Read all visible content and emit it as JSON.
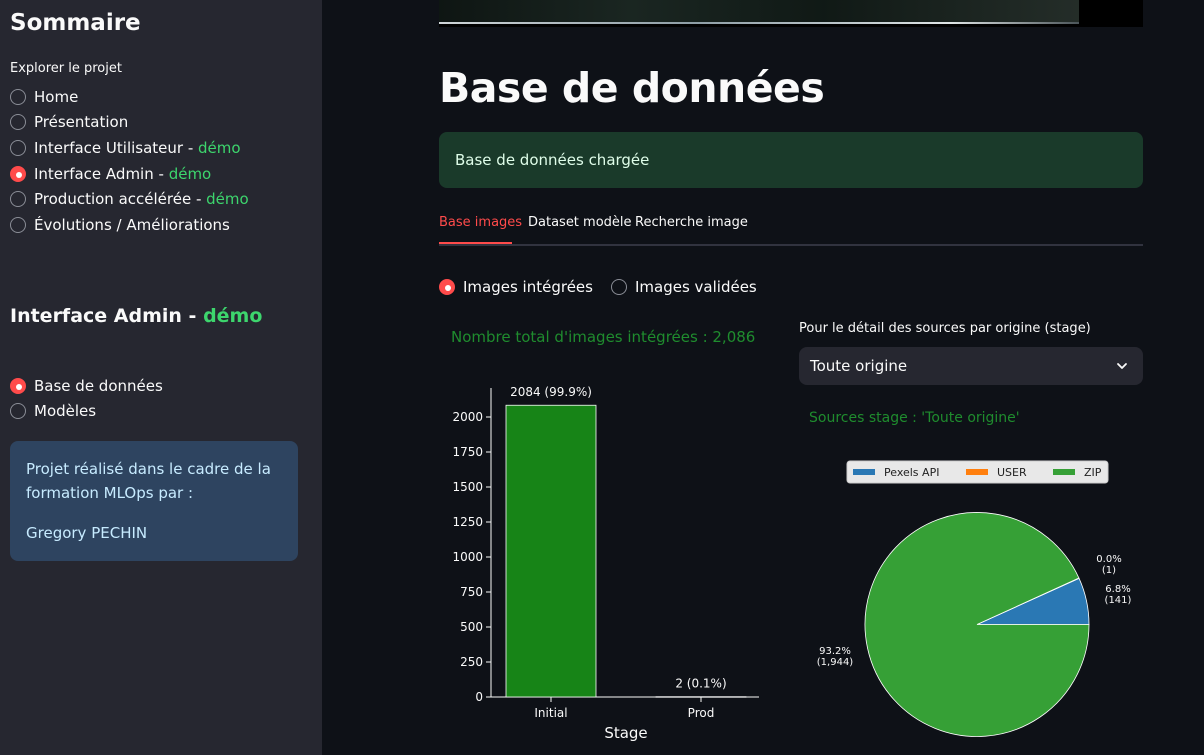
{
  "sidebar": {
    "title": "Sommaire",
    "caption": "Explorer le projet",
    "nav": [
      {
        "label": "Home",
        "suffix": "",
        "green": "",
        "selected": false
      },
      {
        "label": "Présentation",
        "suffix": "",
        "green": "",
        "selected": false
      },
      {
        "label": "Interface Utilisateur",
        "suffix": " - ",
        "green": "démo",
        "selected": false
      },
      {
        "label": "Interface Admin",
        "suffix": " - ",
        "green": "démo",
        "selected": true
      },
      {
        "label": "Production accélérée",
        "suffix": " - ",
        "green": "démo",
        "selected": false
      },
      {
        "label": "Évolutions / Améliorations",
        "suffix": "",
        "green": "",
        "selected": false
      }
    ],
    "section_title": "Interface Admin",
    "section_sep": " - ",
    "section_green": "démo",
    "subnav": [
      {
        "label": "Base de données",
        "selected": true
      },
      {
        "label": "Modèles",
        "selected": false
      }
    ],
    "info_line1": "Projet réalisé dans le cadre de la formation MLOps par :",
    "info_line2": "Gregory PECHIN"
  },
  "main": {
    "title": "Base de données",
    "success": "Base de données chargée",
    "tabs": [
      {
        "label": "Base images",
        "active": true
      },
      {
        "label": "Dataset modèle",
        "active": false
      },
      {
        "label": "Recherche image",
        "active": false
      }
    ],
    "image_radio": [
      {
        "label": "Images intégrées",
        "selected": true
      },
      {
        "label": "Images validées",
        "selected": false
      }
    ],
    "total_text": "Nombre total d'images intégrées : 2,086",
    "select_label": "Pour le détail des sources par origine (stage)",
    "select_value": "Toute origine",
    "pie_title": "Sources stage : 'Toute origine'"
  },
  "colors": {
    "accent": "#ff4b4b",
    "bar": "#178417",
    "pie_pexels": "#2a78b4",
    "pie_user": "#ff7f0e",
    "pie_zip": "#36a036"
  },
  "chart_data": [
    {
      "type": "bar",
      "categories": [
        "Initial",
        "Prod"
      ],
      "values": [
        2084,
        2
      ],
      "data_labels": [
        "2084 (99.9%)",
        "2 (0.1%)"
      ],
      "xlabel": "Stage",
      "ylabel": "",
      "yticks": [
        0,
        250,
        500,
        750,
        1000,
        1250,
        1500,
        1750,
        2000
      ],
      "ylim": [
        0,
        2200
      ]
    },
    {
      "type": "pie",
      "categories": [
        "Pexels API",
        "USER",
        "ZIP"
      ],
      "values": [
        141,
        1,
        1944
      ],
      "data_labels": [
        "6.8%\n(141)",
        "0.0%\n(1)",
        "93.2%\n(1,944)"
      ],
      "legend": "top"
    }
  ]
}
